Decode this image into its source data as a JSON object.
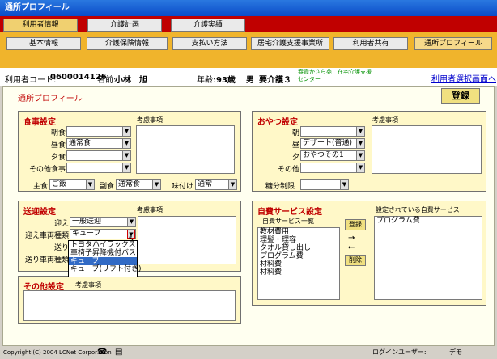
{
  "window": {
    "title": "通所プロフィール"
  },
  "top_buttons": [
    "利用者情報",
    "介護計画",
    "介護実績"
  ],
  "tabs": [
    "基本情報",
    "介護保険情報",
    "支払い方法",
    "居宅介護支援事業所",
    "利用者共有",
    "通所プロフィール"
  ],
  "info": {
    "code_label": "利用者コード:",
    "code_value": "0600014126",
    "name_label": "名前:",
    "name_value": "小林　旭",
    "age_label": "年齢:",
    "age_value": "93歳",
    "gender": "男",
    "care_level": "要介護３",
    "facility": "春霞かさら苑　在宅介護支援センター",
    "select_link": "利用者選択画面へ"
  },
  "page_title": "通所プロフィール",
  "register_button": "登録",
  "meal": {
    "title": "食事設定",
    "note": "考慮事項",
    "rows": [
      {
        "label": "朝食",
        "value": ""
      },
      {
        "label": "昼食",
        "value": "通常食"
      },
      {
        "label": "夕食",
        "value": ""
      },
      {
        "label": "その他食事",
        "value": ""
      }
    ],
    "staple_label": "主食",
    "staple_value": "ご飯",
    "side_label": "副食",
    "side_value": "通常食",
    "seasoning_label": "味付け",
    "seasoning_value": "通常"
  },
  "snack": {
    "title": "おやつ設定",
    "note": "考慮事項",
    "rows": [
      {
        "label": "朝",
        "value": ""
      },
      {
        "label": "昼",
        "value": "デザート(普通)"
      },
      {
        "label": "夕",
        "value": "おやつその1"
      },
      {
        "label": "その他",
        "value": ""
      }
    ],
    "limit_label": "糖分制限",
    "limit_value": ""
  },
  "transport": {
    "title": "送迎設定",
    "note": "考慮事項",
    "pickup_label": "迎え",
    "pickup_value": "一般送迎",
    "pickup_vehicle_label": "迎え車両種類",
    "pickup_vehicle_value": "キューブ",
    "dropoff_label": "送り",
    "dropoff_vehicle_label": "送り車両種類",
    "dropdown_options": [
      "トヨタハイラックス",
      "車椅子昇降機付バス",
      "キューブ",
      "キューブ(リフト付き)"
    ],
    "dropdown_selected": "キューブ"
  },
  "other": {
    "title": "その他設定",
    "note": "考慮事項"
  },
  "selfpay": {
    "title": "自費サービス設定",
    "list_label": "自費サービス一覧",
    "items": [
      "教材費用",
      "理髪・理容",
      "タオル貸し出し",
      "プログラム費",
      "材料費",
      "材料費"
    ],
    "add_button": "登録",
    "delete_button": "削除",
    "configured_label": "設定されている自費サービス",
    "configured_items": [
      "プログラム費"
    ]
  },
  "status": {
    "copyright": "Copyright (C) 2004 LCNet Corporation",
    "user_label": "ログインユーザー:",
    "user_value": "デモ"
  }
}
